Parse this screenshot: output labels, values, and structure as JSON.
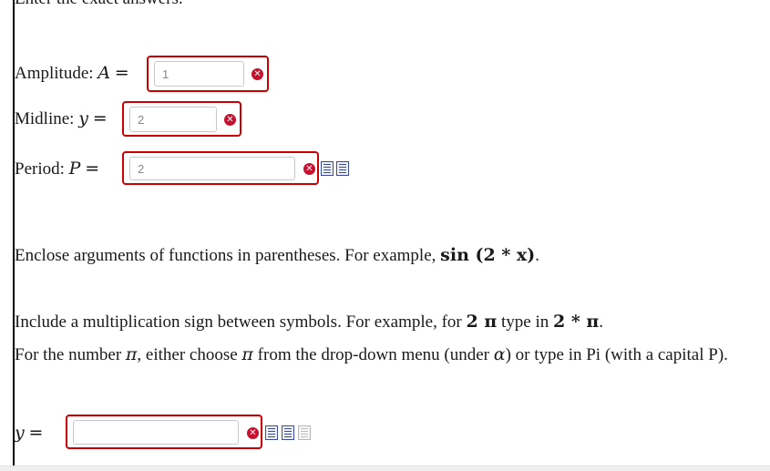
{
  "instructions": {
    "header": "Enter the exact answers."
  },
  "amplitude": {
    "label": "Amplitude:",
    "var": "A",
    "eq": "=",
    "value": "1"
  },
  "midline": {
    "label": "Midline:",
    "var": "y",
    "eq": "=",
    "value": "2"
  },
  "period": {
    "label": "Period:",
    "var": "P",
    "eq": "=",
    "value": "2"
  },
  "hint1": {
    "text": "Enclose arguments of functions in parentheses. For example,",
    "example": "sin (2 * x)",
    "end": "."
  },
  "hint2": {
    "text": "Include a multiplication sign between symbols. For example, for",
    "example_from": "2 π",
    "mid": "type in",
    "example_to": "2 * π",
    "end": "."
  },
  "hint3": {
    "a": "For the number",
    "pi": "π",
    "b": ", either choose",
    "pi2": "π",
    "c": "from the drop-down menu (under",
    "alpha": "α",
    "d": ") or type in Pi (with a capital P)."
  },
  "answer": {
    "var": "y",
    "eq": "=",
    "value": ""
  },
  "icons": {
    "error": "error-x-icon",
    "preview": "preview-icon",
    "equation_editor": "equation-editor-icon",
    "graph": "graph-icon"
  }
}
